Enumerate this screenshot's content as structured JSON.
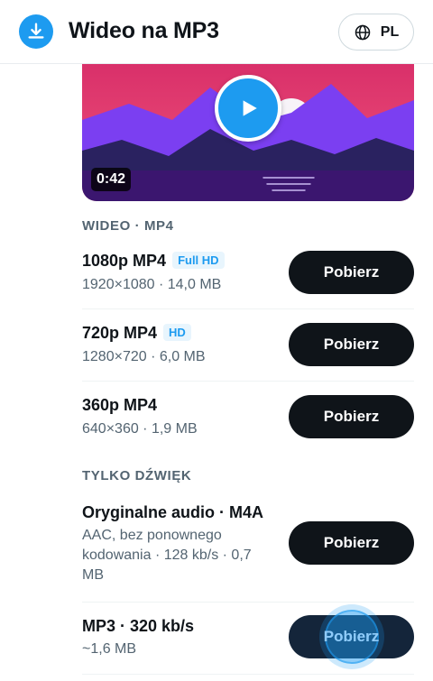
{
  "header": {
    "title": "Wideo na MP3",
    "logo_icon": "download-icon",
    "lang_icon": "globe-icon",
    "lang_label": "PL"
  },
  "player": {
    "duration": "0:42",
    "play_icon": "play-icon",
    "colors": {
      "sky": "#e83a6b",
      "mountain_back": "#7a3ff0",
      "mountain_front": "#2b2360",
      "water": "#3a1870",
      "play": "#1d9bf0"
    }
  },
  "sections": {
    "video_label": "WIDEO · MP4",
    "audio_label": "TYLKO DŹWIĘK"
  },
  "video_options": [
    {
      "title": "1080p MP4",
      "badge": "Full HD",
      "details": "1920×1080 · 14,0 MB",
      "button": "Pobierz"
    },
    {
      "title": "720p MP4",
      "badge": "HD",
      "details": "1280×720 · 6,0 MB",
      "button": "Pobierz"
    },
    {
      "title": "360p MP4",
      "details": "640×360 · 1,9 MB",
      "button": "Pobierz"
    }
  ],
  "audio_options": [
    {
      "title": "Oryginalne audio · M4A",
      "details": "AAC, bez ponownego kodowania · 128 kb/s · 0,7 MB",
      "button": "Pobierz"
    },
    {
      "title": "MP3 · 320 kb/s",
      "details": "~1,6 MB",
      "button": "Pobierz"
    }
  ],
  "colors": {
    "accent": "#1d9bf0",
    "button": "#0f1419",
    "muted": "#536471"
  }
}
